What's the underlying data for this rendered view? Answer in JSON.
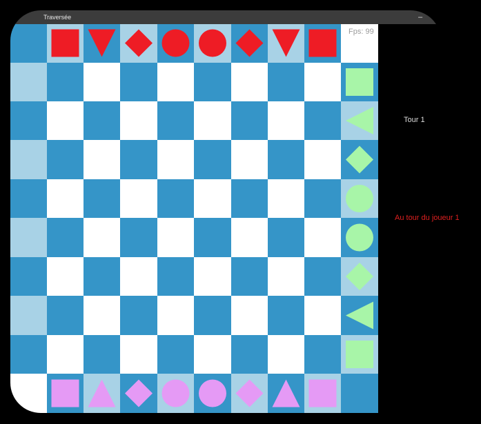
{
  "window": {
    "title": "Traversée",
    "minimize_label": "–"
  },
  "status": {
    "fps": "Fps: 99",
    "turn": "Tour 1",
    "current_player": "Au tour du joueur 1"
  },
  "colors": {
    "dark_square": "#3595c8",
    "light_square": "#ffffff",
    "edge_square_light": "#a8d2e6",
    "player1": "#ee1c25",
    "player2": "#a8f5a8",
    "player3": "#e59af5",
    "player_label": "#e02020"
  },
  "board": {
    "rows": 10,
    "cols": 10,
    "pieces": [
      {
        "row": 0,
        "col": 1,
        "shape": "square",
        "player": "player1"
      },
      {
        "row": 0,
        "col": 2,
        "shape": "triangle-down",
        "player": "player1"
      },
      {
        "row": 0,
        "col": 3,
        "shape": "diamond",
        "player": "player1"
      },
      {
        "row": 0,
        "col": 4,
        "shape": "circle",
        "player": "player1"
      },
      {
        "row": 0,
        "col": 5,
        "shape": "circle",
        "player": "player1"
      },
      {
        "row": 0,
        "col": 6,
        "shape": "diamond",
        "player": "player1"
      },
      {
        "row": 0,
        "col": 7,
        "shape": "triangle-down",
        "player": "player1"
      },
      {
        "row": 0,
        "col": 8,
        "shape": "square",
        "player": "player1"
      },
      {
        "row": 1,
        "col": 9,
        "shape": "square",
        "player": "player2"
      },
      {
        "row": 2,
        "col": 9,
        "shape": "triangle-left",
        "player": "player2"
      },
      {
        "row": 3,
        "col": 9,
        "shape": "diamond",
        "player": "player2"
      },
      {
        "row": 4,
        "col": 9,
        "shape": "circle",
        "player": "player2"
      },
      {
        "row": 5,
        "col": 9,
        "shape": "circle",
        "player": "player2"
      },
      {
        "row": 6,
        "col": 9,
        "shape": "diamond",
        "player": "player2"
      },
      {
        "row": 7,
        "col": 9,
        "shape": "triangle-left",
        "player": "player2"
      },
      {
        "row": 8,
        "col": 9,
        "shape": "square",
        "player": "player2"
      },
      {
        "row": 9,
        "col": 1,
        "shape": "square",
        "player": "player3"
      },
      {
        "row": 9,
        "col": 2,
        "shape": "triangle-up",
        "player": "player3"
      },
      {
        "row": 9,
        "col": 3,
        "shape": "diamond",
        "player": "player3"
      },
      {
        "row": 9,
        "col": 4,
        "shape": "circle",
        "player": "player3"
      },
      {
        "row": 9,
        "col": 5,
        "shape": "circle",
        "player": "player3"
      },
      {
        "row": 9,
        "col": 6,
        "shape": "diamond",
        "player": "player3"
      },
      {
        "row": 9,
        "col": 7,
        "shape": "triangle-up",
        "player": "player3"
      },
      {
        "row": 9,
        "col": 8,
        "shape": "square",
        "player": "player3"
      }
    ]
  }
}
